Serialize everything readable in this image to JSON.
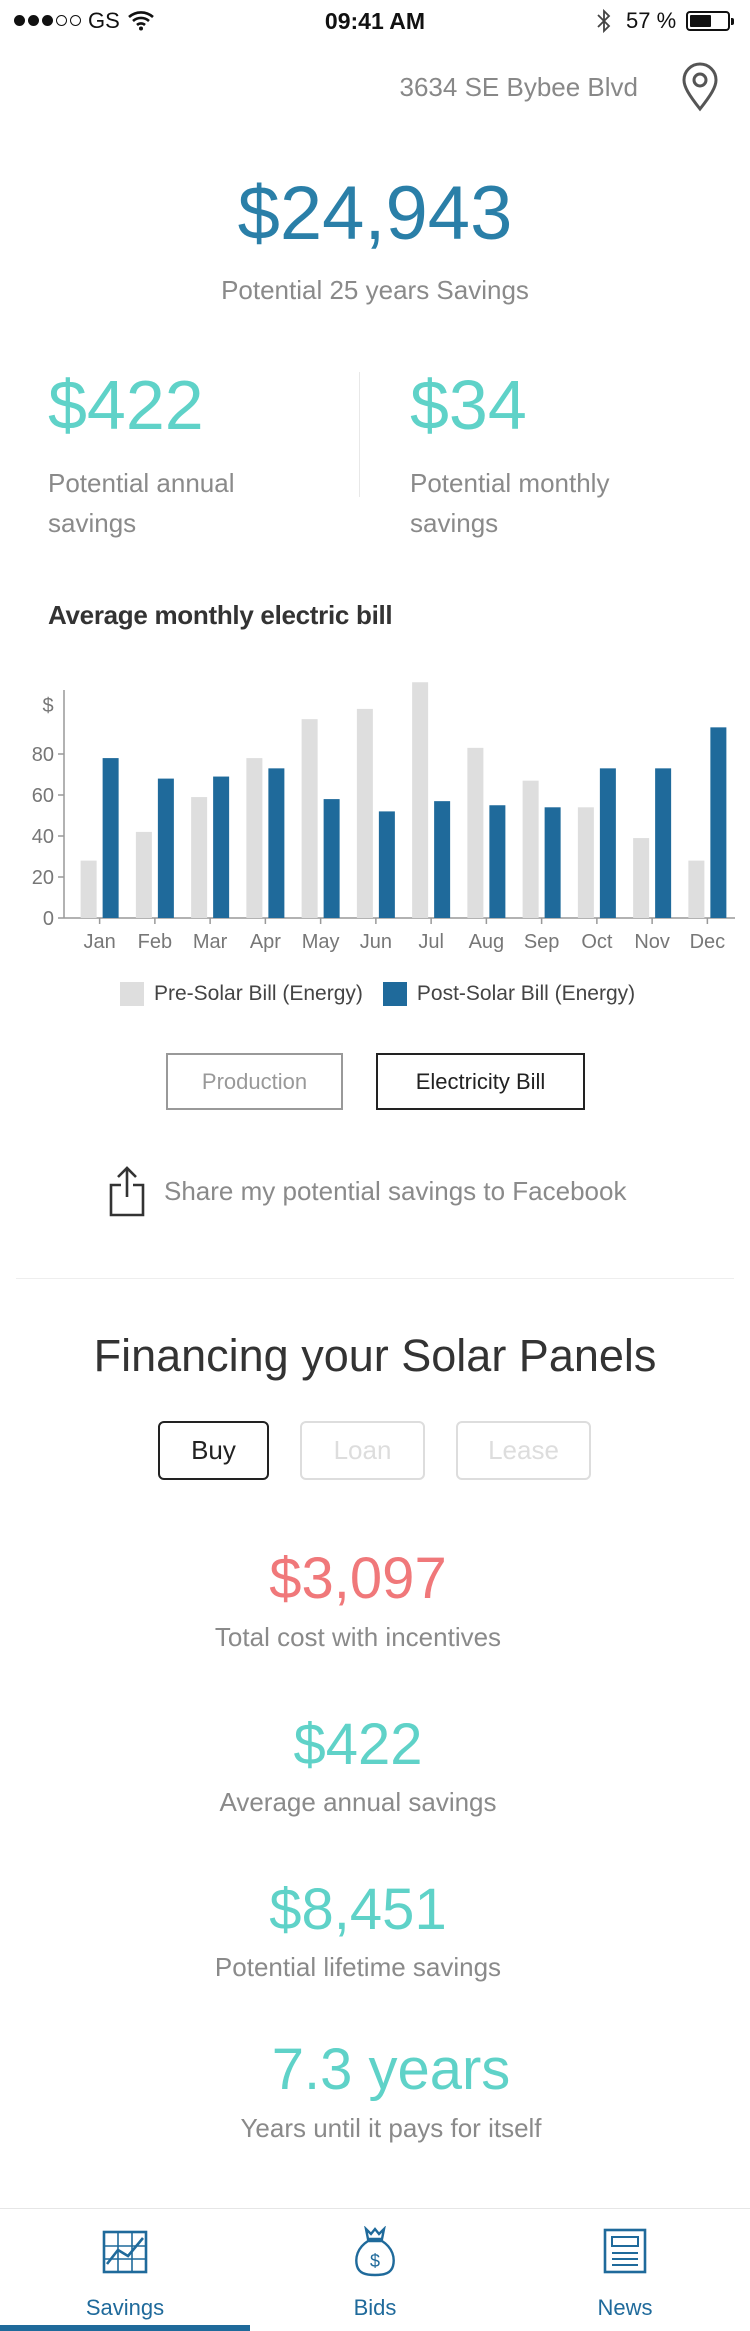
{
  "status_bar": {
    "carrier": "GS",
    "time": "09:41 AM",
    "battery_text": "57 %",
    "battery_level": 0.57
  },
  "header": {
    "address": "3634 SE Bybee Blvd",
    "pin_icon": "location-pin-icon"
  },
  "summary": {
    "total_savings": "$24,943",
    "total_savings_label": "Potential 25 years Savings",
    "annual_value": "$422",
    "annual_label": "Potential annual savings",
    "monthly_value": "$34",
    "monthly_label": "Potential monthly savings"
  },
  "chart_section": {
    "title": "Average monthly electric bill"
  },
  "chart_data": {
    "type": "bar",
    "title": "Average monthly electric bill",
    "ylabel": "$",
    "xlabel": "",
    "ylim": [
      0,
      100
    ],
    "yticks": [
      0,
      20,
      40,
      60,
      80
    ],
    "categories": [
      "Jan",
      "Feb",
      "Mar",
      "Apr",
      "May",
      "Jun",
      "Jul",
      "Aug",
      "Sep",
      "Oct",
      "Nov",
      "Dec"
    ],
    "series": [
      {
        "name": "Pre-Solar Bill (Energy)",
        "color": "#dedede",
        "values": [
          28,
          42,
          59,
          78,
          97,
          102,
          115,
          83,
          67,
          54,
          39,
          28
        ]
      },
      {
        "name": "Post-Solar Bill (Energy)",
        "color": "#1f6a9b",
        "values": [
          78,
          68,
          69,
          73,
          58,
          52,
          57,
          55,
          54,
          73,
          73,
          93
        ]
      }
    ],
    "legend_position": "bottom",
    "grid": false
  },
  "chart_toggle": {
    "production_label": "Production",
    "electricity_label": "Electricity Bill",
    "active": "Electricity Bill"
  },
  "share": {
    "text": "Share my potential savings to Facebook",
    "icon": "share-icon"
  },
  "financing": {
    "title": "Financing your Solar Panels",
    "options": [
      "Buy",
      "Loan",
      "Lease"
    ],
    "selected": "Buy",
    "total_cost_value": "$3,097",
    "total_cost_label": "Total cost with incentives",
    "annual_value": "$422",
    "annual_label": "Average annual savings",
    "lifetime_value": "$8,451",
    "lifetime_label": "Potential lifetime savings",
    "payback_value": "7.3 years",
    "payback_label": "Years until it pays for itself"
  },
  "tabbar": {
    "tabs": [
      {
        "label": "Savings",
        "icon": "chart-icon"
      },
      {
        "label": "Bids",
        "icon": "money-bag-icon"
      },
      {
        "label": "News",
        "icon": "newspaper-icon"
      }
    ],
    "active": "Savings"
  },
  "colors": {
    "primary_blue": "#2a7fa8",
    "teal": "#5fd2c8",
    "coral": "#f0787a",
    "navy": "#1f6a9b",
    "grey_bar": "#dedede"
  }
}
